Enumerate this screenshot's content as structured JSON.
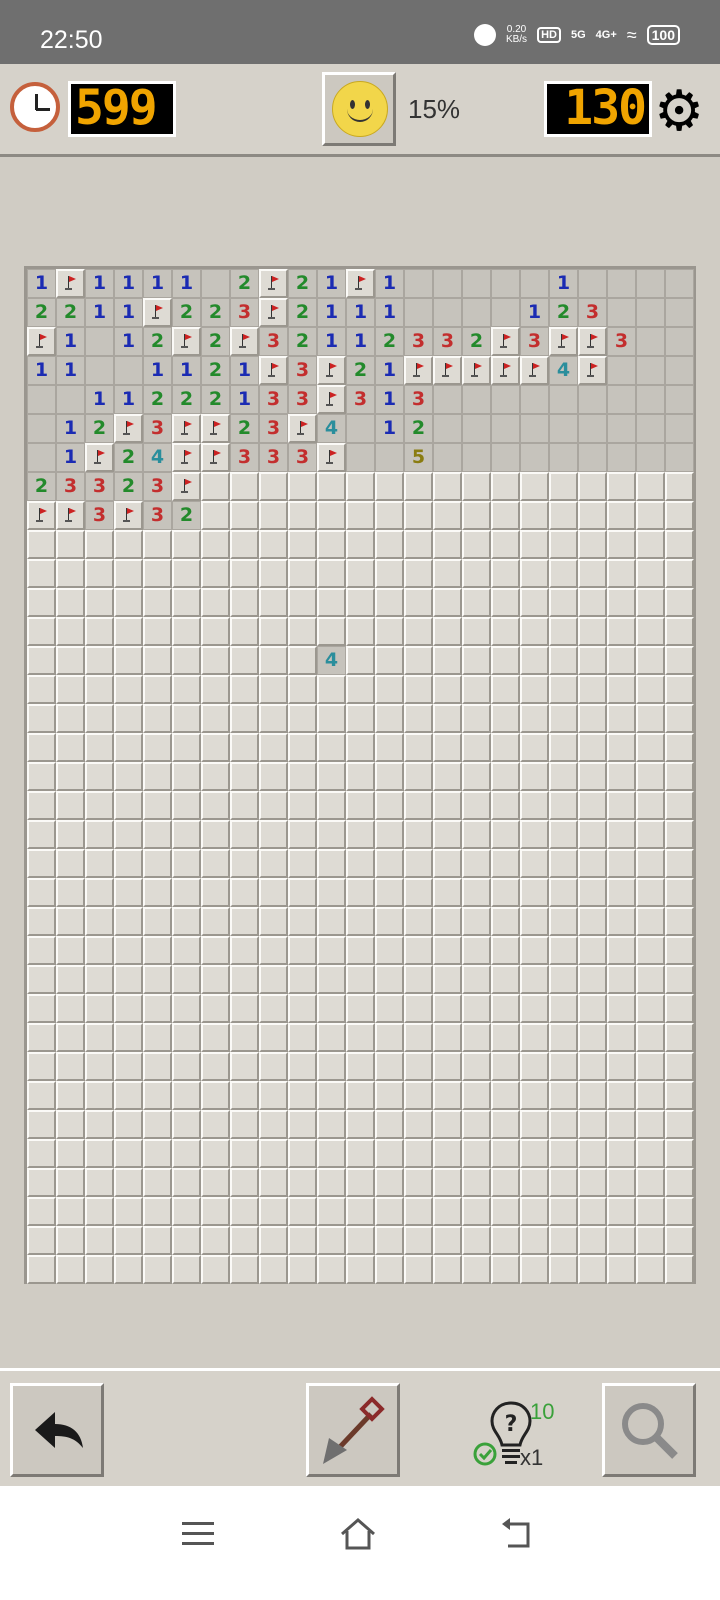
{
  "status_bar": {
    "time": "22:50",
    "net_speed_top": "0.20",
    "net_speed_unit": "KB/s",
    "hd_label": "HD",
    "net_1": "5G",
    "net_2": "4G+",
    "battery": "100"
  },
  "top_bar": {
    "timer": "599",
    "progress_percent": "15%",
    "mines_remaining": "130"
  },
  "board": {
    "cols": 23,
    "rows": 35,
    "grid": [
      "1F1111.2F21F1.....1....",
      "2211F223F2111....123...",
      "F1.12F2F32112332F3FF3..",
      "11..1121F3F21FFFFF4F...",
      "..11222133F313.........",
      ".12F3FF23F4.12.........",
      ".1F24FF333F..5.........",
      "23323F#################",
      "FF3F32#################",
      "#######################",
      "#######################",
      "#######################",
      "#######################",
      "##########4############",
      "#######################",
      "#######################",
      "#######################",
      "#######################",
      "#######################",
      "#######################",
      "#######################",
      "#######################",
      "#######################",
      "#######################",
      "#######################",
      "#######################",
      "#######################",
      "#######################",
      "#######################",
      "#######################",
      "#######################",
      "#######################",
      "#######################",
      "#######################",
      "#######################"
    ],
    "legend": {
      "#": "covered",
      "F": "flag-icon",
      ".": "empty-open",
      "1-8": "adjacent-mine-count"
    },
    "colors": {
      "1": "#1b2bb3",
      "2": "#238a2b",
      "3": "#c32e2e",
      "4": "#2a8e9c",
      "5": "#8a7c10"
    }
  },
  "bottom_bar": {
    "hint_count": "10",
    "hint_multiplier": "x1"
  }
}
